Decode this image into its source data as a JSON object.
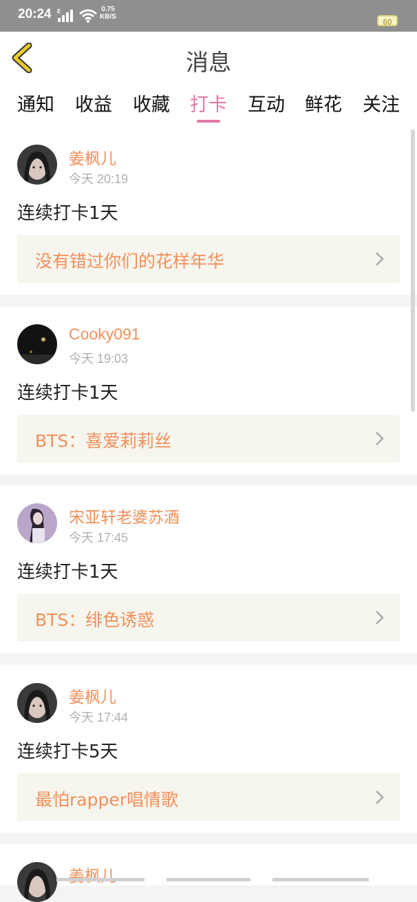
{
  "status_bar": {
    "time": "20:24",
    "network_type": "E",
    "speed_value": "0.75",
    "speed_unit": "KB/S",
    "battery": "60"
  },
  "header": {
    "title": "消息",
    "back_icon": "chevron-left-icon"
  },
  "tabs": [
    {
      "label": "通知",
      "active": false
    },
    {
      "label": "收益",
      "active": false
    },
    {
      "label": "收藏",
      "active": false
    },
    {
      "label": "打卡",
      "active": true
    },
    {
      "label": "互动",
      "active": false
    },
    {
      "label": "鲜花",
      "active": false
    },
    {
      "label": "关注",
      "active": false
    }
  ],
  "messages": [
    {
      "user": "姜枫儿",
      "time": "今天 20:19",
      "text": "连续打卡1天",
      "link": "没有错过你们的花样年华",
      "avatar": "girl-portrait"
    },
    {
      "user": "Cooky091",
      "time": "今天 19:03",
      "text": "连续打卡1天",
      "link": "BTS：喜爱莉莉丝",
      "avatar": "night-scene"
    },
    {
      "user": "宋亚轩老婆苏酒",
      "time": "今天 17:45",
      "text": "连续打卡1天",
      "link": "BTS：绯色诱惑",
      "avatar": "purple-girl"
    },
    {
      "user": "姜枫儿",
      "time": "今天 17:44",
      "text": "连续打卡5天",
      "link": "最怕rapper唱情歌",
      "avatar": "girl-portrait"
    },
    {
      "user": "姜枫儿",
      "time": "",
      "text": "",
      "link": "",
      "avatar": "girl-portrait"
    }
  ],
  "colors": {
    "accent_pink": "#e377a7",
    "username_orange": "#f2905a",
    "back_icon_yellow": "#e7cb2c"
  }
}
